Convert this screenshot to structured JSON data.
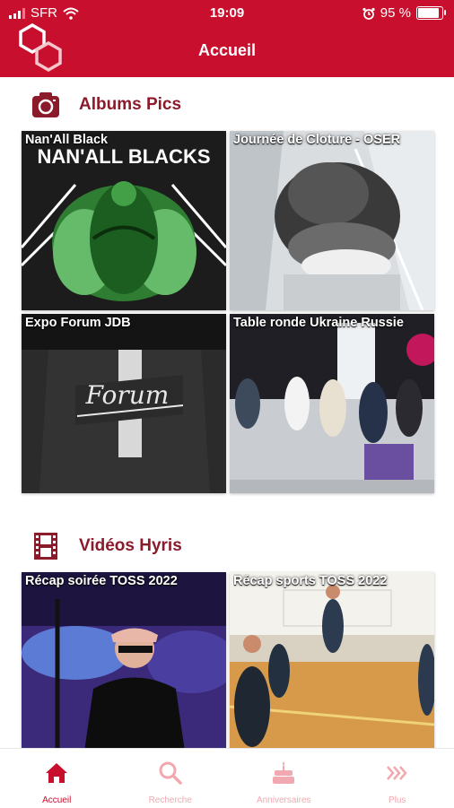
{
  "status_bar": {
    "carrier": "SFR",
    "time": "19:09",
    "battery": "95 %",
    "battery_level": 0.95
  },
  "header": {
    "title": "Accueil",
    "logo_icon": "hexagon-logo-icon"
  },
  "albums": {
    "title": "Albums Pics",
    "icon": "camera-icon",
    "items": [
      {
        "label": "Nan'All Black"
      },
      {
        "label": "Journée de Cloture - OSER"
      },
      {
        "label": "Expo Forum JDB"
      },
      {
        "label": "Table ronde Ukraine Russie"
      }
    ]
  },
  "videos": {
    "title": "Vidéos Hyris",
    "icon": "film-strip-icon",
    "items": [
      {
        "label": "Récap soirée TOSS 2022"
      },
      {
        "label": "Récap sports TOSS 2022"
      }
    ]
  },
  "image_text": {
    "nanall_shirt": "NAN'ALL BLACKS",
    "forum_shirt": "Forum"
  },
  "tabs": [
    {
      "label": "Accueil",
      "icon": "home-icon",
      "active": true
    },
    {
      "label": "Recherche",
      "icon": "search-icon",
      "active": false
    },
    {
      "label": "Anniversaires",
      "icon": "cake-icon",
      "active": false
    },
    {
      "label": "Plus",
      "icon": "chevrons-right-icon",
      "active": false
    }
  ],
  "colors": {
    "primary": "#c8102e",
    "section_title": "#8b1a2b",
    "tab_inactive": "#f2a8b0"
  }
}
